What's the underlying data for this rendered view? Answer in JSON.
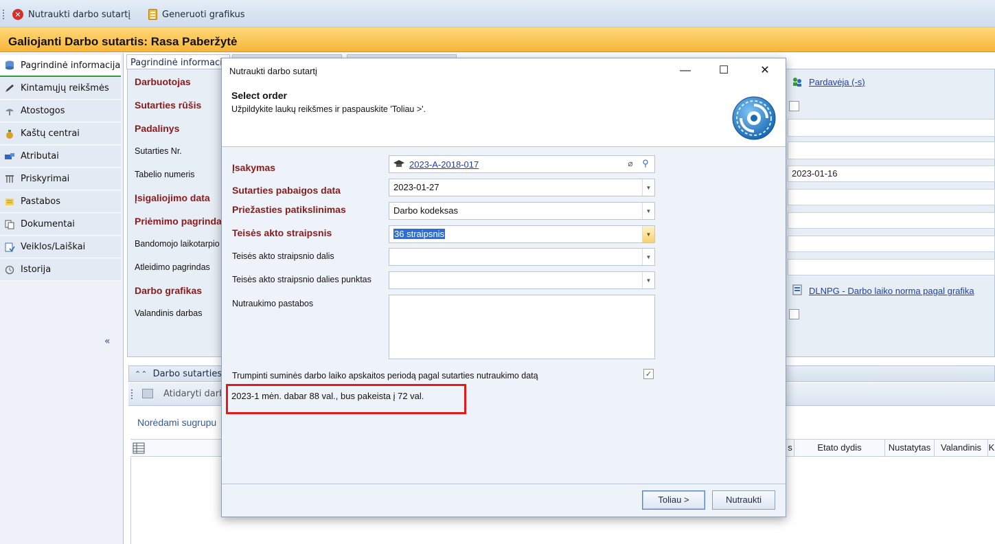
{
  "toolbar": {
    "terminate_label": "Nutraukti darbo sutartį",
    "generate_label": "Generuoti grafikus"
  },
  "window_title": "Galiojanti Darbo sutartis: Rasa Paberžytė",
  "nav": {
    "items": [
      {
        "label": "Pagrindinė informacija",
        "icon": "database-icon"
      },
      {
        "label": "Kintamųjų reikšmės",
        "icon": "pencil-icon"
      },
      {
        "label": "Atostogos",
        "icon": "umbrella-icon"
      },
      {
        "label": "Kaštų centrai",
        "icon": "money-bag-icon"
      },
      {
        "label": "Atributai",
        "icon": "tag-icon"
      },
      {
        "label": "Priskyrimai",
        "icon": "columns-icon"
      },
      {
        "label": "Pastabos",
        "icon": "note-icon"
      },
      {
        "label": "Dokumentai",
        "icon": "documents-icon"
      },
      {
        "label": "Veiklos/Laiškai",
        "icon": "activity-icon"
      },
      {
        "label": "Istorija",
        "icon": "history-icon"
      }
    ],
    "collapse": "«"
  },
  "bg": {
    "tab_main": "Pagrindinė informaci",
    "labels": {
      "darbuotojas": "Darbuotojas",
      "sutarties_rusis": "Sutarties rūšis",
      "padalinys": "Padalinys",
      "sutarties_nr": "Sutarties Nr.",
      "tabelio_numeris": "Tabelio numeris",
      "isigaliojimo_data": "Įsigaliojimo data",
      "priemimo_pagrindas": "Priėmimo pagrinda",
      "bandomojo": "Bandomojo laikotarpio",
      "atleidimo": "Atleidimo pagrindas",
      "darbo_grafikas": "Darbo grafikas",
      "valandinis": "Valandinis darbas"
    },
    "right": {
      "pardaveja_link": "Pardavėja (-s)",
      "date_value": "2023-01-16",
      "dlnpg_link": "DLNPG - Darbo laiko norma pagal grafika"
    },
    "group_header": "Darbo sutarties is",
    "open_label": "Atidaryti darb",
    "group_hint": "Norėdami sugrupu",
    "grid_columns": [
      "s",
      "Etato dydis",
      "Nustatytas",
      "Valandinis",
      "K"
    ]
  },
  "dialog": {
    "title": "Nutraukti darbo sutartį",
    "header_title": "Select order",
    "header_subtitle": "Užpildykite laukų reikšmes ir paspauskite 'Toliau >'.",
    "fields": {
      "isakymas_label": "Įsakymas",
      "isakymas_value": "2023-A-2018-017",
      "pabaigos_label": "Sutarties pabaigos data",
      "pabaigos_value": "2023-01-27",
      "priezastis_label": "Priežasties patikslinimas",
      "priezastis_value": "Darbo kodeksas",
      "straipsnis_label": "Teisės akto straipsnis",
      "straipsnis_value": "36 straipsnis",
      "dalis_label": "Teisės akto straipsnio dalis",
      "dalis_value": "",
      "punktas_label": "Teisės akto straipsnio dalies punktas",
      "punktas_value": "",
      "pastabos_label": "Nutraukimo pastabos"
    },
    "trump_label": "Trumpinti suminės darbo laiko apskaitos periodą pagal sutarties nutraukimo datą",
    "trump_checked": "✓",
    "info_text": "2023-1 mėn. dabar 88 val., bus pakeista į 72 val.",
    "next_label": "Toliau >",
    "cancel_label": "Nutraukti",
    "win_min": "—",
    "win_max": "☐",
    "win_close": "✕"
  },
  "colors": {
    "accent": "#f7b63a",
    "required": "#8b1a1a",
    "link": "#1d3fb0",
    "highlight_border": "#e11a1a",
    "selection": "#2b6fd6"
  }
}
